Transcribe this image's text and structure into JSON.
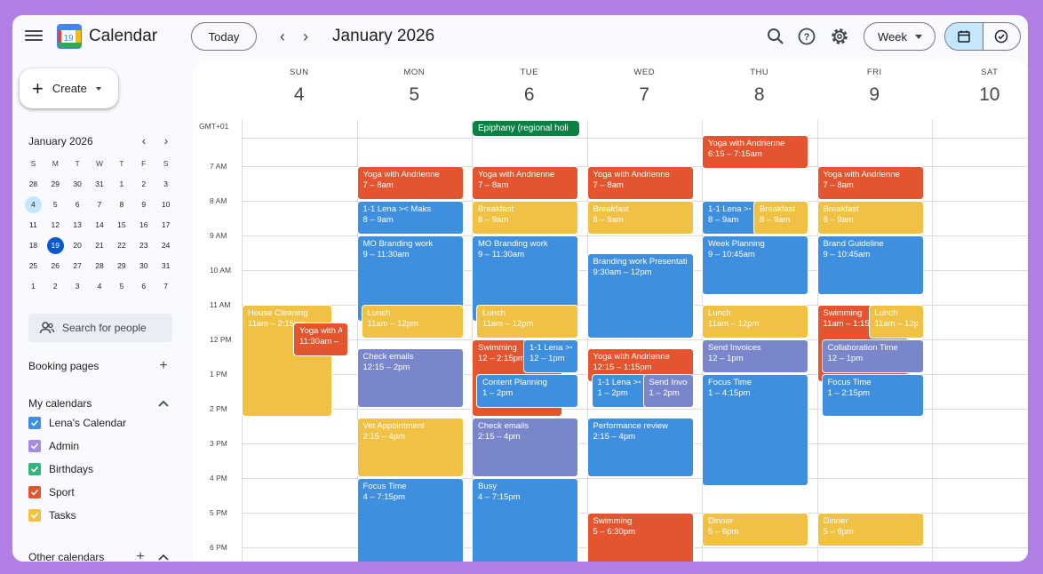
{
  "header": {
    "app_title": "Calendar",
    "logo_text": "19",
    "today_label": "Today",
    "month_title": "January 2026",
    "view_label": "Week"
  },
  "sidebar": {
    "create_label": "Create",
    "mini": {
      "title": "January 2026",
      "dow": [
        "S",
        "M",
        "T",
        "W",
        "T",
        "F",
        "S"
      ],
      "weeks": [
        [
          "28",
          "29",
          "30",
          "31",
          "1",
          "2",
          "3"
        ],
        [
          "4",
          "5",
          "6",
          "7",
          "8",
          "9",
          "10"
        ],
        [
          "11",
          "12",
          "13",
          "14",
          "15",
          "16",
          "17"
        ],
        [
          "18",
          "19",
          "20",
          "21",
          "22",
          "23",
          "24"
        ],
        [
          "25",
          "26",
          "27",
          "28",
          "29",
          "30",
          "31"
        ],
        [
          "1",
          "2",
          "3",
          "4",
          "5",
          "6",
          "7"
        ]
      ]
    },
    "search_placeholder": "Search for people",
    "booking_label": "Booking pages",
    "my_calendars_label": "My calendars",
    "calendars": [
      {
        "name": "Lena's Calendar",
        "color": "#3f8fe0"
      },
      {
        "name": "Admin",
        "color": "#a58be3"
      },
      {
        "name": "Birthdays",
        "color": "#33b679"
      },
      {
        "name": "Sport",
        "color": "#e4552f"
      },
      {
        "name": "Tasks",
        "color": "#f0c143"
      }
    ],
    "other_calendars_label": "Other calendars"
  },
  "week": {
    "tz_label": "GMT+01",
    "days": [
      {
        "dow": "SUN",
        "num": "4"
      },
      {
        "dow": "MON",
        "num": "5"
      },
      {
        "dow": "TUE",
        "num": "6"
      },
      {
        "dow": "WED",
        "num": "7"
      },
      {
        "dow": "THU",
        "num": "8"
      },
      {
        "dow": "FRI",
        "num": "9"
      },
      {
        "dow": "SAT",
        "num": "10"
      }
    ],
    "hours": [
      "7 AM",
      "8 AM",
      "9 AM",
      "10 AM",
      "11 AM",
      "12 PM",
      "1 PM",
      "2 PM",
      "3 PM",
      "4 PM",
      "5 PM",
      "6 PM"
    ],
    "allday": {
      "title": "Epiphany (regional holi"
    }
  },
  "events": [
    {
      "title": "House Cleaning",
      "time": "11am – 2:15pm"
    },
    {
      "title": "Yoga with A",
      "time": "11:30am – 1"
    },
    {
      "title": "Yoga with Andrienne",
      "time": "7 – 8am"
    },
    {
      "title": "1-1 Lena >< Maks",
      "time": "8 – 9am"
    },
    {
      "title": "MO Branding work",
      "time": "9 – 11:30am"
    },
    {
      "title": "Lunch",
      "time": "11am – 12pm"
    },
    {
      "title": "Check emails",
      "time": "12:15 – 2pm"
    },
    {
      "title": "Vet Appointment",
      "time": "2:15 – 4pm"
    },
    {
      "title": "Focus Time",
      "time": "4 – 7:15pm"
    },
    {
      "title": "Yoga with Andrienne",
      "time": "7 – 8am"
    },
    {
      "title": "Breakfast",
      "time": "8 – 9am"
    },
    {
      "title": "MO Branding work",
      "time": "9 – 11:30am"
    },
    {
      "title": "Lunch",
      "time": "11am – 12pm"
    },
    {
      "title": "Swimming",
      "time": "12 – 2:15pm"
    },
    {
      "title": "1-1 Lena ><",
      "time": "12 – 1pm"
    },
    {
      "title": "Content Planning",
      "time": "1 – 2pm"
    },
    {
      "title": "Check emails",
      "time": "2:15 – 4pm"
    },
    {
      "title": "Busy",
      "time": "4 – 7:15pm"
    },
    {
      "title": "Yoga with Andrienne",
      "time": "7 – 8am"
    },
    {
      "title": "Breakfast",
      "time": "8 – 9am"
    },
    {
      "title": "Branding work Presentation",
      "time": "9:30am – 12pm"
    },
    {
      "title": "Yoga with Andrienne",
      "time": "12:15 – 1:15pm"
    },
    {
      "title": "1-1 Lena ><",
      "time": "1 – 2pm"
    },
    {
      "title": "Send Invoic",
      "time": "1 – 2pm"
    },
    {
      "title": "Performance review",
      "time": "2:15 – 4pm"
    },
    {
      "title": "Swimming",
      "time": "5 – 6:30pm"
    },
    {
      "title": "Yoga with Andrienne",
      "time": "6:15 – 7:15am"
    },
    {
      "title": "1-1 Lena ><",
      "time": "8 – 9am"
    },
    {
      "title": "Breakfast",
      "time": "8 – 9am"
    },
    {
      "title": "Week Planning",
      "time": "9 – 10:45am"
    },
    {
      "title": "Lunch",
      "time": "11am – 12pm"
    },
    {
      "title": "Send Invoices",
      "time": "12 – 1pm"
    },
    {
      "title": "Focus Time",
      "time": "1 – 4:15pm"
    },
    {
      "title": "Dinner",
      "time": "5 – 6pm"
    },
    {
      "title": "Yoga with Andrienne",
      "time": "7 – 8am"
    },
    {
      "title": "Breakfast",
      "time": "8 – 9am"
    },
    {
      "title": "Brand Guideline",
      "time": "9 – 10:45am"
    },
    {
      "title": "Swimming",
      "time": "11am – 1:15p"
    },
    {
      "title": "Lunch",
      "time": "11am – 12p"
    },
    {
      "title": "Collaboration Time",
      "time": "12 – 1pm"
    },
    {
      "title": "Focus Time",
      "time": "1 – 2:15pm"
    },
    {
      "title": "Dinner",
      "time": "5 – 6pm"
    }
  ]
}
